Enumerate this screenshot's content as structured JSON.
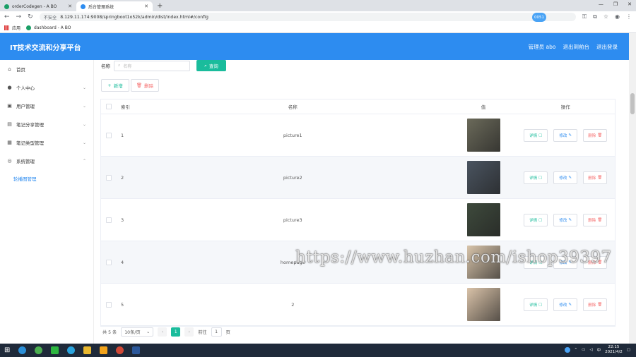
{
  "browser": {
    "tabs": [
      {
        "title": "orderCodegen - A BO",
        "color": "#1a9f66"
      },
      {
        "title": "后台管理系统",
        "color": "#2d8cf0"
      }
    ],
    "url_insecure_label": "不安全",
    "url": "8.129.11.174:9008/springboot1o52k/admin/dist/index.html#/config",
    "bookmarks": [
      "应用",
      "dashboard - A BO"
    ]
  },
  "header": {
    "title": "IT技术交流和分享平台",
    "badge": "0051",
    "links": [
      "管理员 abo",
      "退出到前台",
      "退出登录"
    ]
  },
  "sidebar": {
    "items": [
      {
        "label": "首页",
        "icon": "home-icon",
        "glyph": "⌂"
      },
      {
        "label": "个人中心",
        "icon": "user-icon",
        "glyph": "●"
      },
      {
        "label": "用户管理",
        "icon": "users-icon",
        "glyph": "▣"
      },
      {
        "label": "笔记分享管理",
        "icon": "note-icon",
        "glyph": "▤"
      },
      {
        "label": "笔记类型管理",
        "icon": "category-icon",
        "glyph": "▦"
      },
      {
        "label": "系统管理",
        "icon": "settings-icon",
        "glyph": "◎"
      }
    ],
    "sub_item": "轮播图管理"
  },
  "search": {
    "label": "名称",
    "placeholder": "名称",
    "button": "查询"
  },
  "actions": {
    "add": "新增",
    "delete": "删除"
  },
  "table": {
    "headers": {
      "index": "索引",
      "name": "名称",
      "value": "值",
      "ops": "操作"
    },
    "rows": [
      {
        "index": "1",
        "name": "picture1",
        "thumb_color": "#6b6a5a"
      },
      {
        "index": "2",
        "name": "picture2",
        "thumb_color": "#4a5460"
      },
      {
        "index": "3",
        "name": "picture3",
        "thumb_color": "#3e4a3c"
      },
      {
        "index": "4",
        "name": "homepage",
        "thumb_color": "#d8c4aa"
      },
      {
        "index": "5",
        "name": "2",
        "thumb_color": "#d9c2a8"
      }
    ],
    "op_labels": {
      "detail": "详情",
      "edit": "修改",
      "delete": "删除"
    }
  },
  "pagination": {
    "total": "共 5 条",
    "page_size": "10条/页",
    "current_page": "1",
    "goto_label": "前往",
    "goto_value": "1",
    "goto_suffix": "页"
  },
  "watermark": "https://www.huzhan.com/ishop39397",
  "taskbar": {
    "time": "22:15",
    "date": "2021/4/2",
    "ime": "中"
  }
}
